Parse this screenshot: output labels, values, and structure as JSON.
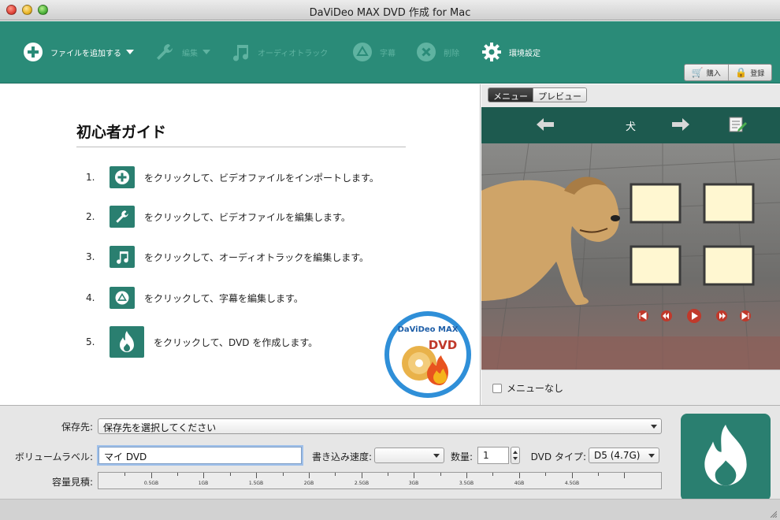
{
  "window": {
    "title": "DaViDeo MAX DVD 作成 for Mac"
  },
  "toolbar": {
    "add_file": "ファイルを追加する",
    "edit": "編集",
    "audio_track": "オーディオトラック",
    "subtitle": "字幕",
    "delete": "削除",
    "preferences": "環境設定",
    "buy": "購入",
    "register": "登録"
  },
  "guide": {
    "title": "初心者ガイド",
    "steps": [
      {
        "num": "1.",
        "icon": "add-icon",
        "text": "をクリックして、ビデオファイルをインポートします。"
      },
      {
        "num": "2.",
        "icon": "wrench-icon",
        "text": "をクリックして、ビデオファイルを編集します。"
      },
      {
        "num": "3.",
        "icon": "music-note-icon",
        "text": "をクリックして、オーディオトラックを編集します。"
      },
      {
        "num": "4.",
        "icon": "subtitle-icon",
        "text": "をクリックして、字幕を編集します。"
      },
      {
        "num": "5.",
        "icon": "flame-icon",
        "text": "をクリックして、DVD を作成します。"
      }
    ],
    "logo_brand": "DaViDeo MAX",
    "logo_text": "DVD"
  },
  "preview": {
    "tabs": [
      "メニュー",
      "プレビュー"
    ],
    "active_tab": 0,
    "menu_title": "犬",
    "no_menu_label": "メニューなし"
  },
  "settings": {
    "save_to_label": "保存先:",
    "save_to_value": "保存先を選択してください",
    "volume_label_label": "ボリュームラベル:",
    "volume_label_value": "マイ DVD",
    "write_speed_label": "書き込み速度:",
    "write_speed_value": "",
    "quantity_label": "数量:",
    "quantity_value": "1",
    "dvd_type_label": "DVD タイプ:",
    "dvd_type_value": "D5 (4.7G)",
    "capacity_label": "容量見積:",
    "capacity_ticks": [
      "0.5GB",
      "1GB",
      "1.5GB",
      "2GB",
      "2.5GB",
      "3GB",
      "3.5GB",
      "4GB",
      "4.5GB"
    ],
    "capacity_used_fraction": 0
  },
  "colors": {
    "toolbar_bg": "#2a8b78",
    "accent_dark": "#2a7f70",
    "menu_header": "#1d5a4f",
    "disabled_text": "#5fb3a1"
  }
}
